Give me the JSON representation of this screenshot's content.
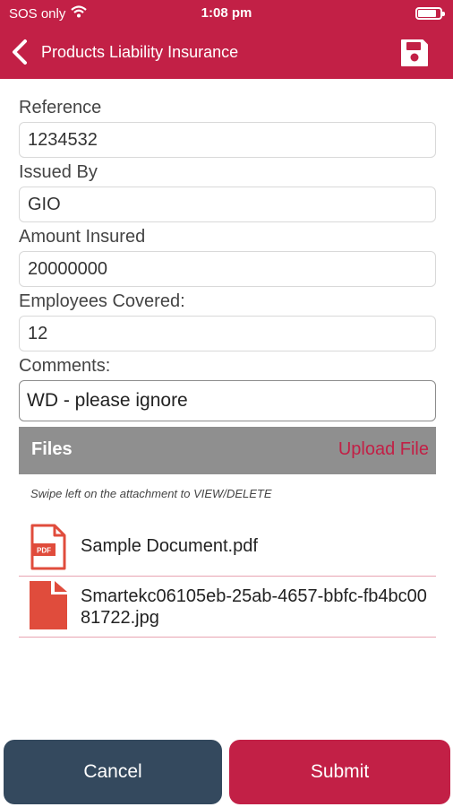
{
  "status_bar": {
    "carrier": "SOS only",
    "time": "1:08 pm",
    "battery_level": 0.85
  },
  "nav": {
    "title": "Products Liability Insurance",
    "back_icon": "chevron-left-icon",
    "save_icon": "floppy-disk-icon"
  },
  "form": {
    "reference": {
      "label": "Reference",
      "value": "1234532"
    },
    "issued_by": {
      "label": "Issued By",
      "value": "GIO"
    },
    "amount_insured": {
      "label": "Amount Insured",
      "value": "20000000"
    },
    "employees_covered": {
      "label": "Employees Covered:",
      "value": "12"
    },
    "comments": {
      "label": "Comments:",
      "value": "WD - please ignore"
    }
  },
  "files": {
    "title": "Files",
    "upload_label": "Upload File",
    "hint": "Swipe left on the attachment to VIEW/DELETE",
    "items": [
      {
        "name": "Sample Document.pdf",
        "icon": "pdf-file-icon",
        "icon_badge": "PDF"
      },
      {
        "name": "Smartekc06105eb-25ab-4657-bbfc-fb4bc0081722.jpg",
        "icon": "file-icon"
      }
    ]
  },
  "actions": {
    "cancel_label": "Cancel",
    "submit_label": "Submit"
  },
  "colors": {
    "brand": "#c22046",
    "cancel": "#34495e",
    "files_header": "#8f8f8f"
  }
}
